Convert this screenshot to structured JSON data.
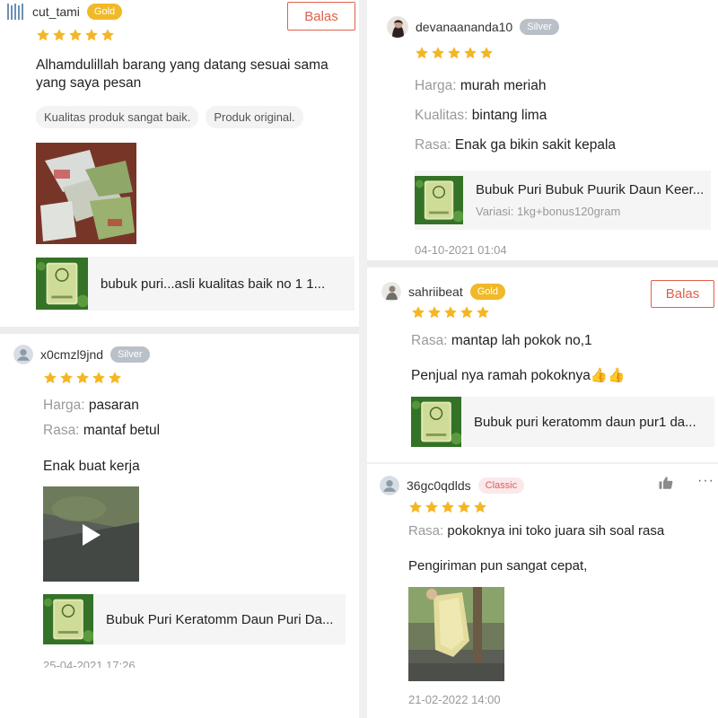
{
  "colors": {
    "accent": "#e0604a",
    "star": "#f5b623",
    "gold_badge": "#f1b928",
    "silver_badge": "#b9c0c8"
  },
  "reviews": [
    {
      "username": "cut_tami",
      "badge": "Gold",
      "rating": 5,
      "reply_label": "Balas",
      "text": [
        "Alhamdulillah barang yang datang sesuai sama",
        "yang saya pesan"
      ],
      "tags": [
        "Kualitas produk sangat baik.",
        "Produk original."
      ],
      "product_name": "bubuk puri...asli kualitas baik no 1 1...",
      "avatar_icon": "barcode-avatar-icon"
    },
    {
      "username": "x0cmzl9jnd",
      "badge": "Silver",
      "rating": 5,
      "fields": [
        {
          "label": "Harga:",
          "value": "pasaran"
        },
        {
          "label": "Rasa:",
          "value": "mantaf betul"
        }
      ],
      "text": "Enak buat kerja",
      "product_name": "Bubuk Puri Keratomm Daun Puri Da...",
      "date": "25-04-2021 17:26",
      "avatar_icon": "default-user-icon"
    },
    {
      "username": "devanaananda10",
      "badge": "Silver",
      "rating": 5,
      "fields": [
        {
          "label": "Harga:",
          "value": "murah meriah"
        },
        {
          "label": "Kualitas:",
          "value": "bintang lima"
        },
        {
          "label": "Rasa:",
          "value": "Enak ga bikin sakit kepala"
        }
      ],
      "product_name": "Bubuk Puri Bubuk Puurik Daun Keer...",
      "variation": "Variasi: 1kg+bonus120gram",
      "date": "04-10-2021 01:04",
      "avatar_icon": "profile-photo-icon"
    },
    {
      "username": "sahriibeat",
      "badge": "Gold",
      "rating": 5,
      "reply_label": "Balas",
      "fields": [
        {
          "label": "Rasa:",
          "value": "mantap lah pokok no,1"
        }
      ],
      "text": "Penjual nya ramah pokoknya👍👍",
      "product_name": "Bubuk puri keratomm daun pur1 da...",
      "avatar_icon": "profile-photo-icon"
    },
    {
      "username": "36gc0qdlds",
      "badge": "Classic",
      "rating": 5,
      "fields": [
        {
          "label": "Rasa:",
          "value": "pokoknya ini toko juara sih soal rasa"
        }
      ],
      "text": "Pengiriman pun sangat cepat,",
      "date": "21-02-2022 14:00",
      "avatar_icon": "default-user-icon"
    }
  ]
}
